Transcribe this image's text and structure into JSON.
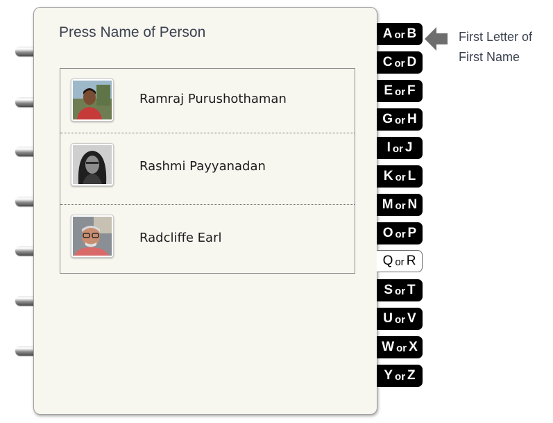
{
  "header": {
    "title": "Press Name of Person"
  },
  "people": [
    {
      "name": "Ramraj Purushothaman",
      "photo": "photo-ramraj"
    },
    {
      "name": "Rashmi Payyanadan",
      "photo": "photo-rashmi"
    },
    {
      "name": "Radcliffe Earl",
      "photo": "photo-radcliffe"
    }
  ],
  "tabs": [
    {
      "a": "A",
      "or": "or",
      "b": "B"
    },
    {
      "a": "C",
      "or": "or",
      "b": "D"
    },
    {
      "a": "E",
      "or": "or",
      "b": "F"
    },
    {
      "a": "G",
      "or": "or",
      "b": "H"
    },
    {
      "a": "I",
      "or": "or",
      "b": "J"
    },
    {
      "a": "K",
      "or": "or",
      "b": "L"
    },
    {
      "a": "M",
      "or": "or",
      "b": "N"
    },
    {
      "a": "O",
      "or": "or",
      "b": "P"
    },
    {
      "a": "Q",
      "or": "or",
      "b": "R"
    },
    {
      "a": "S",
      "or": "or",
      "b": "T"
    },
    {
      "a": "U",
      "or": "or",
      "b": "V"
    },
    {
      "a": "W",
      "or": "or",
      "b": "X"
    },
    {
      "a": "Y",
      "or": "or",
      "b": "Z"
    }
  ],
  "active_tab": "Q or R",
  "hint": {
    "line1": "First Letter of",
    "line2": "First Name",
    "icon": "left-arrow-icon"
  },
  "colors": {
    "tab_bg": "#000000",
    "page_bg": "#f7f6ef",
    "title": "#3b4250"
  }
}
